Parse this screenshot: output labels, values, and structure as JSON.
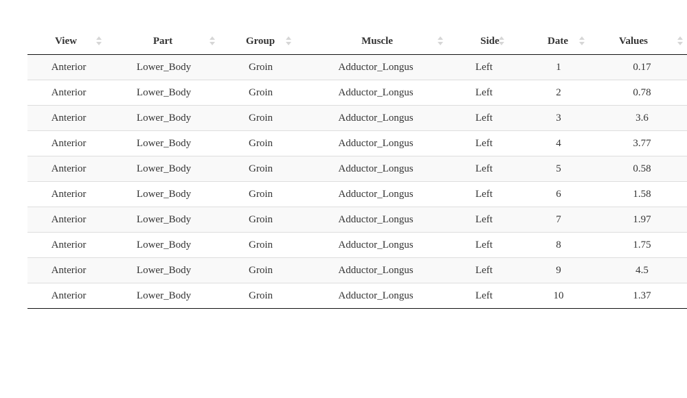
{
  "table": {
    "columns": [
      "View",
      "Part",
      "Group",
      "Muscle",
      "Side",
      "Date",
      "Values"
    ],
    "rows": [
      [
        "Anterior",
        "Lower_Body",
        "Groin",
        "Adductor_Longus",
        "Left",
        "1",
        "0.17"
      ],
      [
        "Anterior",
        "Lower_Body",
        "Groin",
        "Adductor_Longus",
        "Left",
        "2",
        "0.78"
      ],
      [
        "Anterior",
        "Lower_Body",
        "Groin",
        "Adductor_Longus",
        "Left",
        "3",
        "3.6"
      ],
      [
        "Anterior",
        "Lower_Body",
        "Groin",
        "Adductor_Longus",
        "Left",
        "4",
        "3.77"
      ],
      [
        "Anterior",
        "Lower_Body",
        "Groin",
        "Adductor_Longus",
        "Left",
        "5",
        "0.58"
      ],
      [
        "Anterior",
        "Lower_Body",
        "Groin",
        "Adductor_Longus",
        "Left",
        "6",
        "1.58"
      ],
      [
        "Anterior",
        "Lower_Body",
        "Groin",
        "Adductor_Longus",
        "Left",
        "7",
        "1.97"
      ],
      [
        "Anterior",
        "Lower_Body",
        "Groin",
        "Adductor_Longus",
        "Left",
        "8",
        "1.75"
      ],
      [
        "Anterior",
        "Lower_Body",
        "Groin",
        "Adductor_Longus",
        "Left",
        "9",
        "4.5"
      ],
      [
        "Anterior",
        "Lower_Body",
        "Groin",
        "Adductor_Longus",
        "Left",
        "10",
        "1.37"
      ]
    ],
    "sort_icon": "sort-both-icon",
    "colors": {
      "stripe": "#f9f9f9",
      "row_border": "#dddddd",
      "header_border": "#111111",
      "sort_icon": "#d6d6d6"
    }
  }
}
